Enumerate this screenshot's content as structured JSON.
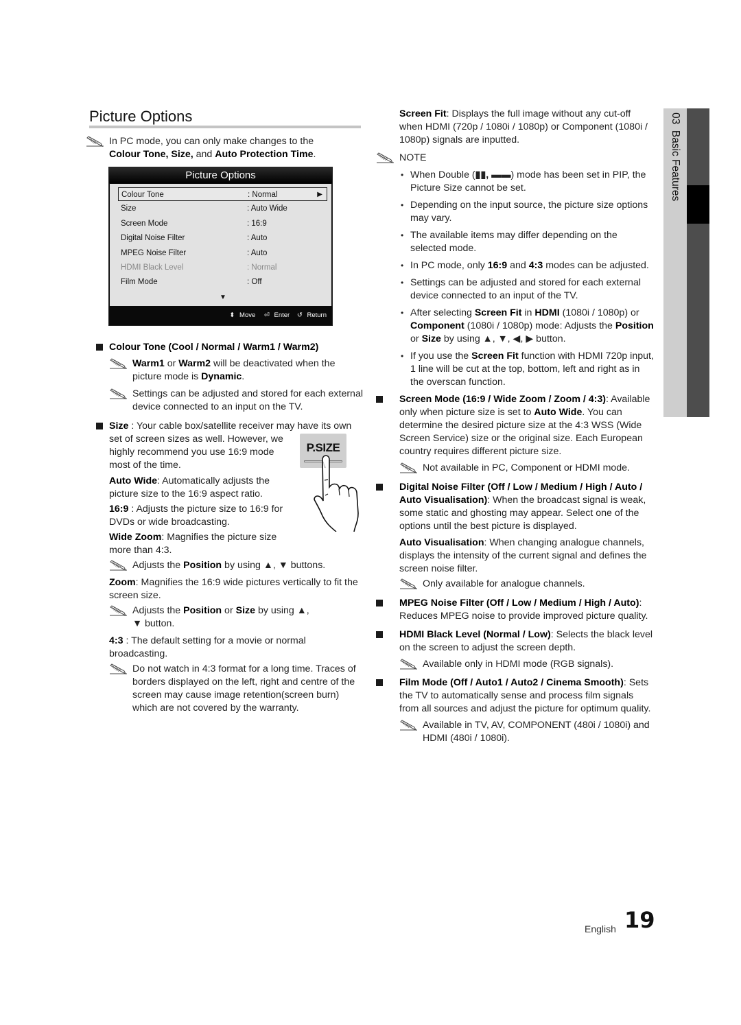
{
  "page": {
    "title": "Picture Options",
    "language": "English",
    "page_number": "19",
    "side_tab": {
      "chapter": "03",
      "label": "Basic Features"
    }
  },
  "left": {
    "intro_note": {
      "line1": "In PC mode, you can only make changes to the",
      "bold1": "Colour Tone, Size,",
      "mid": " and ",
      "bold2": "Auto Protection Time",
      "end": "."
    },
    "osd": {
      "title": "Picture Options",
      "rows": [
        {
          "label": "Colour Tone",
          "value": ": Normal",
          "selected": true,
          "dimmed": false
        },
        {
          "label": "Size",
          "value": ": Auto Wide",
          "selected": false,
          "dimmed": false
        },
        {
          "label": "Screen Mode",
          "value": ": 16:9",
          "selected": false,
          "dimmed": false
        },
        {
          "label": "Digital Noise Filter",
          "value": ": Auto",
          "selected": false,
          "dimmed": false
        },
        {
          "label": "MPEG Noise Filter",
          "value": ": Auto",
          "selected": false,
          "dimmed": false
        },
        {
          "label": "HDMI Black Level",
          "value": ": Normal",
          "selected": false,
          "dimmed": true
        },
        {
          "label": "Film Mode",
          "value": ": Off",
          "selected": false,
          "dimmed": false
        }
      ],
      "right_arrow": "▶",
      "down_arrow": "▼",
      "footer": {
        "move_icon": "⬍",
        "move": "Move",
        "enter_icon": "⏎",
        "enter": "Enter",
        "return_icon": "↺",
        "return": "Return"
      }
    },
    "colour_tone": {
      "heading": "Colour Tone (Cool / Normal / Warm1 / Warm2)",
      "note1": {
        "b1": "Warm1",
        "t1": " or ",
        "b2": "Warm2",
        "t2": " will be deactivated when the picture mode is ",
        "b3": "Dynamic",
        "t3": "."
      },
      "note2": "Settings can be adjusted and stored for each external device connected to an input on the TV."
    },
    "size": {
      "bold": "Size",
      "text": " : Your cable box/satellite receiver may have its own set of screen sizes as well. However, we highly recommend you use 16:9 mode most of the time.",
      "button_label": "P.SIZE",
      "auto_wide": {
        "b": "Auto Wide",
        "t": ": Automatically adjusts the picture size to the 16:9 aspect ratio."
      },
      "r169": {
        "b": "16:9",
        "t": " : Adjusts the picture size to 16:9 for DVDs or wide broadcasting."
      },
      "wide_zoom": {
        "b": "Wide Zoom",
        "t": ": Magnifies the picture size more than 4:3."
      },
      "wide_zoom_note": {
        "t1": "Adjusts the ",
        "b1": "Position",
        "t2": " by using ▲, ▼ buttons."
      },
      "zoom": {
        "b": "Zoom",
        "t": ": Magnifies the 16:9 wide pictures vertically to fit the screen size."
      },
      "zoom_note": {
        "t1": "Adjusts the ",
        "b1": "Position",
        "t2": " or ",
        "b2": "Size",
        "t3": " by using ▲, ▼ button."
      },
      "r43": {
        "b": "4:3",
        "t": " : The default setting for a movie or normal broadcasting."
      },
      "r43_note": "Do not watch in 4:3 format for a long time. Traces of borders displayed on the left, right and centre of the screen may cause image retention(screen burn) which are not covered by the warranty."
    }
  },
  "right": {
    "screen_fit": {
      "b": "Screen Fit",
      "t": ": Displays the full image without any cut-off when HDMI (720p / 1080i / 1080p) or Component (1080i / 1080p) signals are inputted."
    },
    "note_heading": "NOTE",
    "note_bullets": [
      {
        "pre": "When Double (",
        "icons": "▮▮, ▬▬",
        "post": ") mode has been set in PIP, the Picture Size cannot be set."
      },
      {
        "pre": "Depending on the input source, the picture size options may vary."
      },
      {
        "pre": "The available items may differ depending on the selected mode."
      },
      {
        "pre": "In PC mode, only ",
        "b1": "16:9",
        "mid": " and ",
        "b2": "4:3",
        "post": " modes can be adjusted."
      },
      {
        "pre": "Settings can be adjusted and stored for each external device connected to an input of the TV."
      },
      {
        "pre": "After selecting ",
        "b1": "Screen Fit",
        "mid": " in ",
        "b2": "HDMI",
        "mid2": " (1080i / 1080p) or ",
        "b3": "Component",
        "mid3": " (1080i / 1080p) mode: Adjusts the ",
        "b4": "Position",
        "mid4": " or ",
        "b5": "Size",
        "post": " by using ▲, ▼, ◀, ▶ button."
      },
      {
        "pre": "If you use the ",
        "b1": "Screen Fit",
        "post": " function with HDMI 720p input, 1 line will be cut at the top, bottom, left and right as in the overscan function."
      }
    ],
    "screen_mode": {
      "heading": "Screen Mode (16:9 / Wide Zoom / Zoom / 4:3)",
      "t1": "Available only when picture size is set to ",
      "b1": "Auto Wide",
      "t2": ". You can determine the desired picture size at the 4:3 WSS (Wide Screen Service) size or the original size. Each European country requires different picture size.",
      "note": "Not available in PC, Component or HDMI mode."
    },
    "dnf": {
      "heading": "Digital Noise Filter (Off / Low / Medium / High / Auto / Auto Visualisation)",
      "text": ": When the broadcast signal is weak, some static and ghosting may appear. Select one of the options until the best picture is displayed.",
      "av_b": "Auto Visualisation",
      "av_t": ": When changing analogue channels, displays the intensity of the current signal and defines the screen noise filter.",
      "note": "Only available for analogue channels."
    },
    "mpeg": {
      "heading": "MPEG Noise Filter (Off / Low / Medium / High / Auto)",
      "text": ": Reduces MPEG noise to provide improved picture quality."
    },
    "hdmi": {
      "heading": "HDMI Black Level (Normal / Low)",
      "text": ": Selects the black level on the screen to adjust the screen depth.",
      "note": "Available only in HDMI mode (RGB signals)."
    },
    "film": {
      "heading": "Film Mode (Off / Auto1 / Auto2 / Cinema Smooth)",
      "text": ": Sets the TV to automatically sense and process film signals from all sources and adjust the picture for optimum quality.",
      "note": "Available in TV, AV, COMPONENT (480i / 1080i) and HDMI (480i / 1080i)."
    }
  }
}
